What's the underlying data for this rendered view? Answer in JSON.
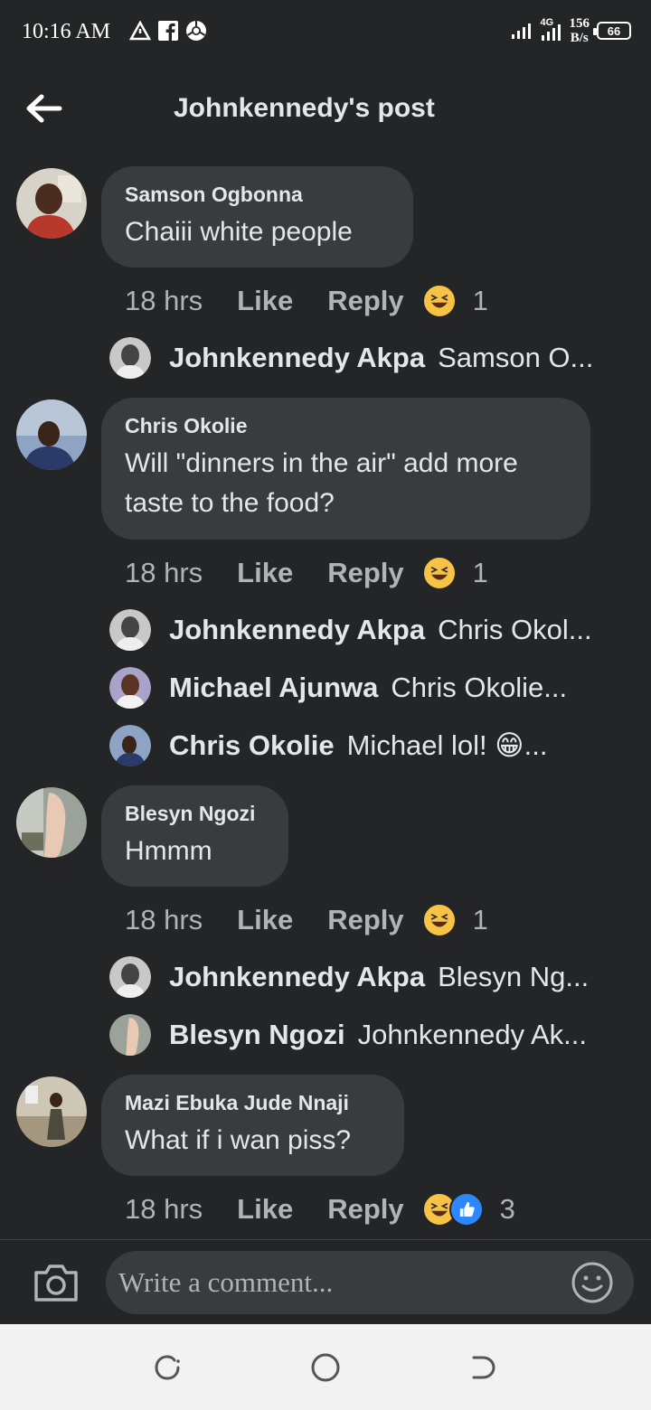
{
  "status_bar": {
    "time": "10:16 AM",
    "network": "4G",
    "speed_value": "156",
    "speed_unit": "B/s",
    "battery": "66"
  },
  "header": {
    "title": "Johnkennedy's post"
  },
  "comments": [
    {
      "author": "Samson Ogbonna",
      "text": "Chaiii white people",
      "time": "18 hrs",
      "like_label": "Like",
      "reply_label": "Reply",
      "reaction_count": "1",
      "replies": [
        {
          "name": "Johnkennedy Akpa",
          "text": "Samson O..."
        }
      ]
    },
    {
      "author": "Chris Okolie",
      "text_line1": "Will \"dinners in the air\" add more",
      "text_line2": "taste to the food?",
      "time": "18 hrs",
      "like_label": "Like",
      "reply_label": "Reply",
      "reaction_count": "1",
      "replies": [
        {
          "name": "Johnkennedy Akpa",
          "text": "Chris Okol..."
        },
        {
          "name": "Michael Ajunwa",
          "text": "Chris Okolie..."
        },
        {
          "name": "Chris Okolie",
          "text": "Michael lol! 😁..."
        }
      ]
    },
    {
      "author": "Blesyn Ngozi",
      "text": "Hmmm",
      "time": "18 hrs",
      "like_label": "Like",
      "reply_label": "Reply",
      "reaction_count": "1",
      "replies": [
        {
          "name": "Johnkennedy Akpa",
          "text": "Blesyn Ng..."
        },
        {
          "name": "Blesyn Ngozi",
          "text": "Johnkennedy Ak..."
        }
      ]
    },
    {
      "author": "Mazi Ebuka Jude Nnaji",
      "text": "What if i wan piss?",
      "time": "18 hrs",
      "like_label": "Like",
      "reply_label": "Reply",
      "reaction_count": "3"
    }
  ],
  "composer": {
    "placeholder": "Write a comment..."
  },
  "colors": {
    "background": "#242526",
    "bubble": "#3a3b3c",
    "haha": "#f7c344",
    "like": "#2d88ff"
  }
}
